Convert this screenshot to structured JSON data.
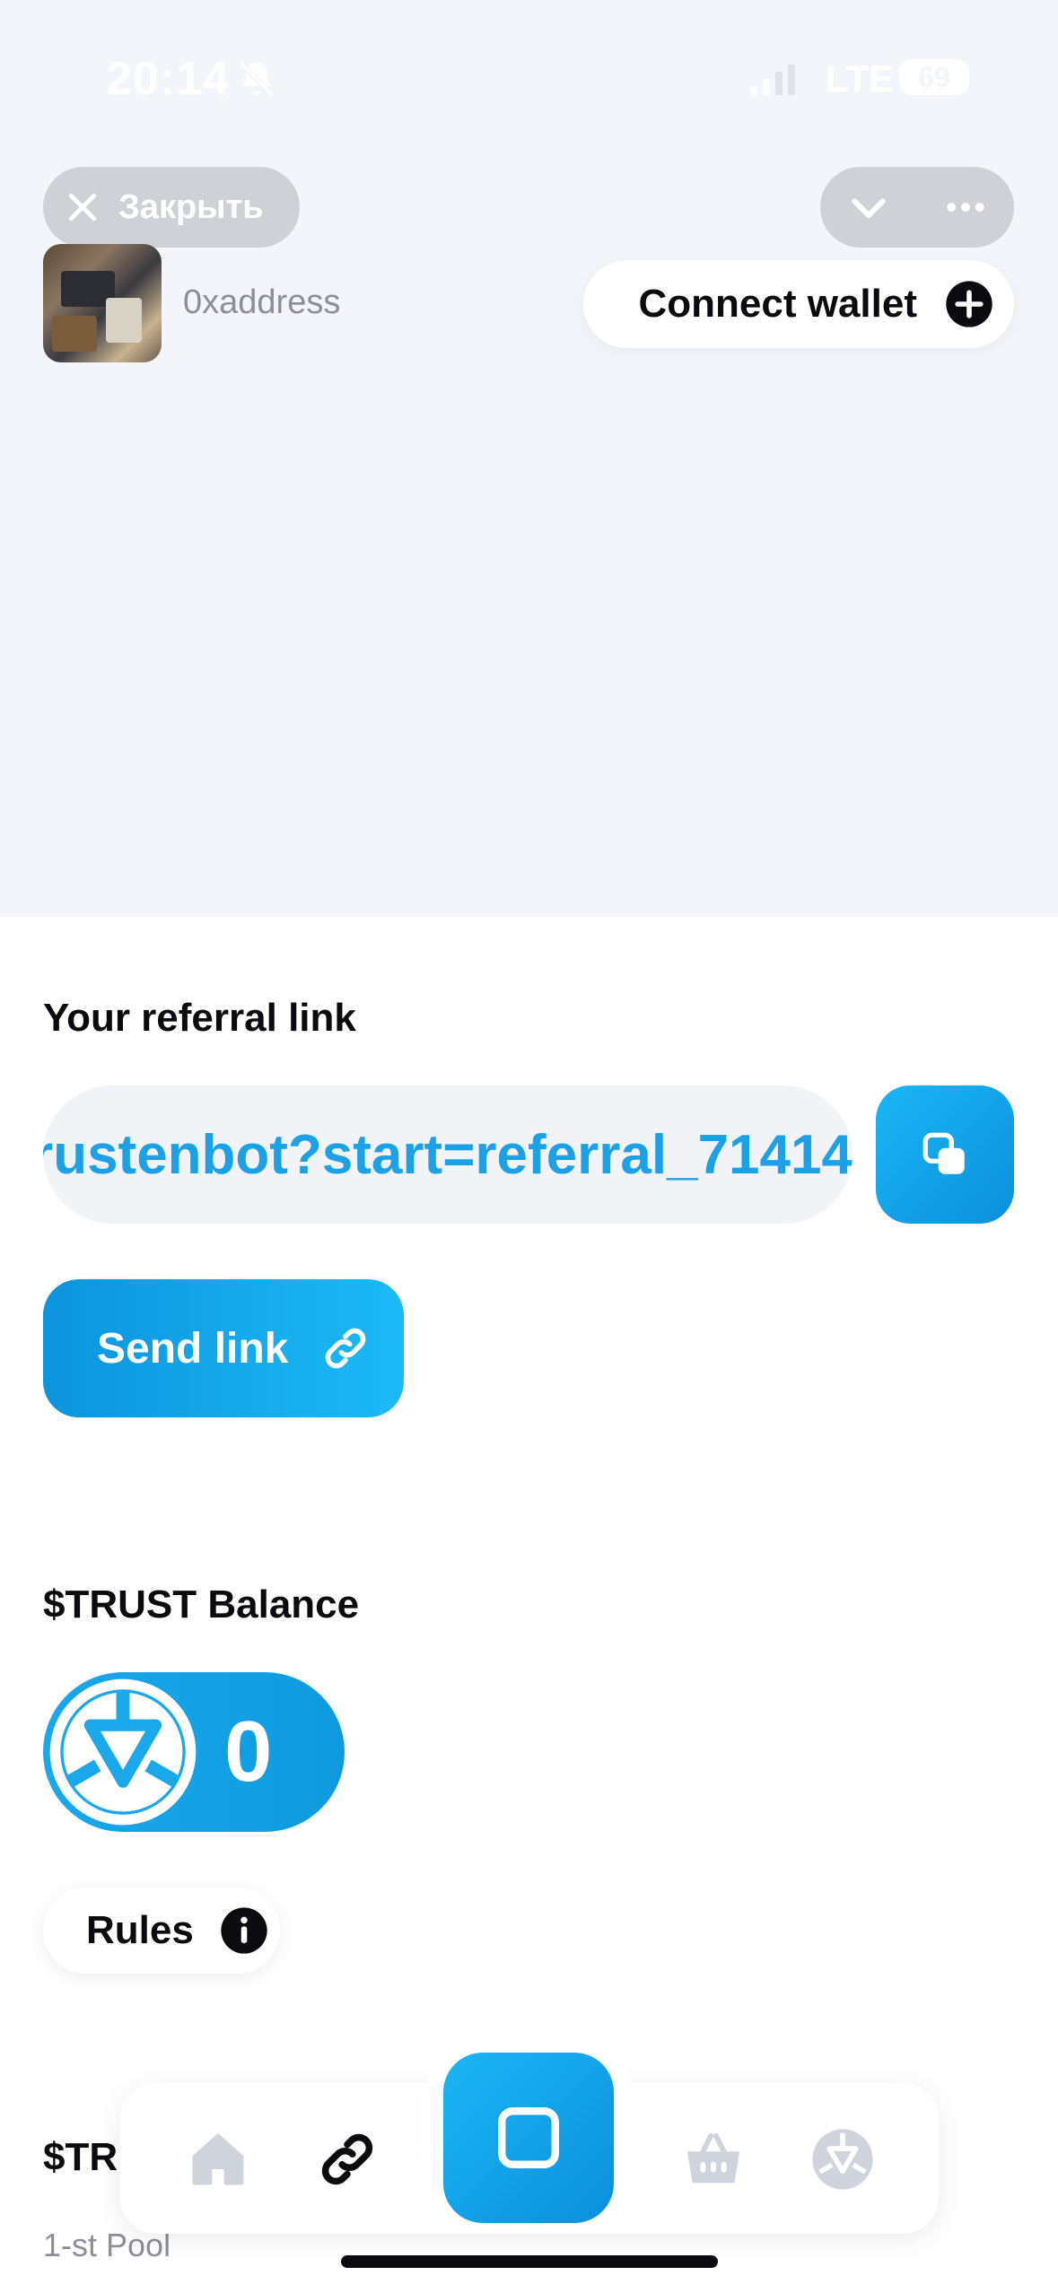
{
  "status_bar": {
    "time": "20:14",
    "network": "LTE",
    "battery": "69"
  },
  "header": {
    "close_label": "Закрыть",
    "address": "0xaddress",
    "connect_wallet_label": "Connect wallet"
  },
  "referral": {
    "title": "Your referral link",
    "link_text": "rustenbot?start=referral_71414",
    "send_link_label": "Send link"
  },
  "balance": {
    "title": "$TRUST Balance",
    "value": "0",
    "rules_label": "Rules"
  },
  "pool": {
    "title_partial": "$TR",
    "subtitle": "1-st Pool"
  },
  "nav": {
    "items": [
      "home-icon",
      "link-icon",
      "square-icon",
      "basket-icon",
      "trust-token-icon"
    ],
    "active": "link-icon"
  },
  "colors": {
    "accent": "#1ca0e6",
    "background_top": "#f4f5fa",
    "nav_inactive": "#cfd3dc"
  }
}
